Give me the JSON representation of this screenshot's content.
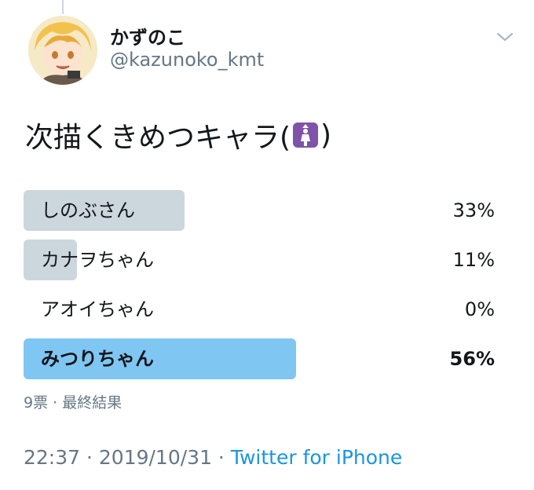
{
  "user": {
    "display_name": "かずのこ",
    "handle": "@kazunoko_kmt"
  },
  "tweet": {
    "text": "次描くきめつキャラ(",
    "text_close": ")",
    "emoji": "womens-restroom-emoji"
  },
  "poll": {
    "options": [
      {
        "label": "しのぶさん",
        "percent_text": "33%",
        "percent": 33
      },
      {
        "label": "カナヲちゃん",
        "percent_text": "11%",
        "percent": 11
      },
      {
        "label": "アオイちゃん",
        "percent_text": "0%",
        "percent": 0
      },
      {
        "label": "みつりちゃん",
        "percent_text": "56%",
        "percent": 56
      }
    ],
    "meta": "9票 · 最終結果"
  },
  "footer": {
    "time_date": "22:37 · 2019/10/31 · ",
    "source": "Twitter for iPhone"
  },
  "colors": {
    "bar": "#ccd6dd",
    "winner_bar": "#7fc6f3",
    "link": "#1b95e0",
    "secondary_text": "#657786",
    "emoji_bg": "#7e53a8"
  },
  "icons": {
    "menu": "chevron-down-icon"
  }
}
